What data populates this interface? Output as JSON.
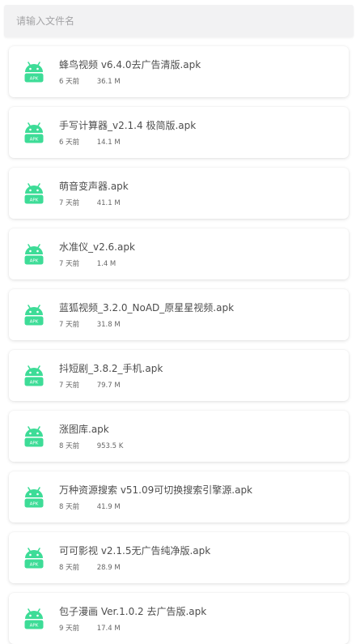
{
  "search": {
    "placeholder": "请输入文件名",
    "value": ""
  },
  "accent_color": "#3ddc97",
  "icon": {
    "name": "android-apk-icon",
    "label": "APK"
  },
  "files": [
    {
      "name": "蜂鸟视频 v6.4.0去广告清版.apk",
      "age": "6 天前",
      "size": "36.1 M"
    },
    {
      "name": "手写计算器_v2.1.4 极简版.apk",
      "age": "6 天前",
      "size": "14.1 M"
    },
    {
      "name": "萌音变声器.apk",
      "age": "7 天前",
      "size": "41.1 M"
    },
    {
      "name": "水准仪_v2.6.apk",
      "age": "7 天前",
      "size": "1.4 M"
    },
    {
      "name": "蓝狐视频_3.2.0_NoAD_原星星视频.apk",
      "age": "7 天前",
      "size": "31.8 M"
    },
    {
      "name": "抖短剧_3.8.2_手机.apk",
      "age": "7 天前",
      "size": "79.7 M"
    },
    {
      "name": "涨图库.apk",
      "age": "8 天前",
      "size": "953.5 K"
    },
    {
      "name": "万种资源搜索 v51.09可切换搜索引擎源.apk",
      "age": "8 天前",
      "size": "41.9 M"
    },
    {
      "name": "可可影视 v2.1.5无广告纯净版.apk",
      "age": "8 天前",
      "size": "28.9 M"
    },
    {
      "name": "包子漫画 Ver.1.0.2 去广告版.apk",
      "age": "9 天前",
      "size": "17.4 M"
    }
  ]
}
